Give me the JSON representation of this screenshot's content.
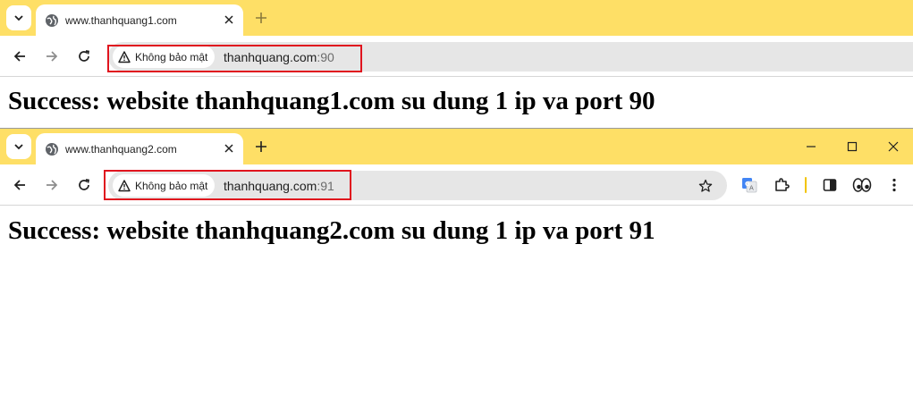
{
  "window1": {
    "tab_title": "www.thanhquang1.com",
    "security_label": "Không bảo mật",
    "url_host": "thanhquang.com",
    "url_port": ":90",
    "heading": "Success: website thanhquang1.com su dung 1 ip va port 90"
  },
  "window2": {
    "tab_title": "www.thanhquang2.com",
    "security_label": "Không bảo mật",
    "url_host": "thanhquang.com",
    "url_port": ":91",
    "heading": "Success: website thanhquang2.com su dung 1 ip va port 91"
  },
  "colors": {
    "tabstrip": "#fedf66",
    "highlight_box": "#e0141e",
    "omnibox": "#e6e6e6"
  },
  "icons": [
    "tab-search-icon",
    "globe-icon",
    "close-icon",
    "plus-icon",
    "back-arrow-icon",
    "forward-arrow-icon",
    "reload-icon",
    "warning-icon",
    "star-icon",
    "google-translate-icon",
    "extensions-icon",
    "side-panel-icon",
    "eyes-extension-icon",
    "more-menu-icon",
    "minimize-icon",
    "maximize-icon",
    "window-close-icon"
  ]
}
